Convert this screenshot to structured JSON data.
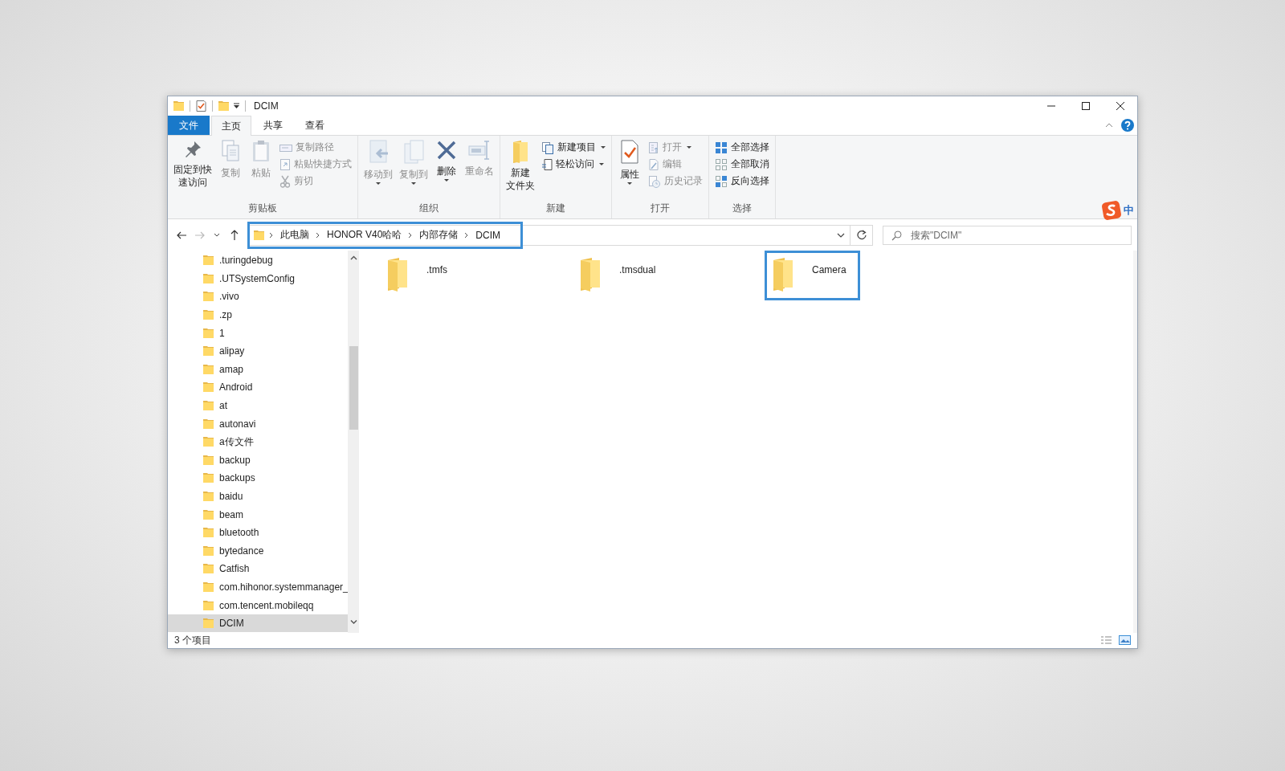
{
  "window": {
    "title": "DCIM"
  },
  "ribbon_tabs": [
    {
      "label": "文件",
      "kind": "file",
      "selected": false
    },
    {
      "label": "主页",
      "kind": "tab",
      "selected": true
    },
    {
      "label": "共享",
      "kind": "tab",
      "selected": false
    },
    {
      "label": "查看",
      "kind": "tab",
      "selected": false
    }
  ],
  "ribbon": {
    "groups": [
      {
        "label": "剪贴板",
        "items": [
          {
            "kind": "large",
            "lines": [
              "固定到快",
              "速访问"
            ],
            "disabled": false,
            "dropdown": false
          },
          {
            "kind": "large",
            "label": "复制",
            "disabled": true,
            "dropdown": false
          },
          {
            "kind": "large",
            "label": "粘贴",
            "disabled": true,
            "dropdown": false
          },
          {
            "kind": "small",
            "label": "复制路径",
            "disabled": true,
            "dropdown": false
          },
          {
            "kind": "small",
            "label": "粘贴快捷方式",
            "disabled": true,
            "dropdown": false
          },
          {
            "kind": "small",
            "label": "剪切",
            "disabled": true,
            "dropdown": false
          }
        ]
      },
      {
        "label": "组织",
        "items": [
          {
            "kind": "large",
            "label": "移动到",
            "disabled": true,
            "dropdown": true
          },
          {
            "kind": "large",
            "label": "复制到",
            "disabled": true,
            "dropdown": true
          },
          {
            "kind": "large",
            "label": "删除",
            "disabled": false,
            "dropdown": true
          },
          {
            "kind": "large",
            "label": "重命名",
            "disabled": true,
            "dropdown": false
          }
        ]
      },
      {
        "label": "新建",
        "items": [
          {
            "kind": "large",
            "lines": [
              "新建",
              "文件夹"
            ],
            "disabled": false,
            "dropdown": false
          },
          {
            "kind": "small",
            "label": "新建项目",
            "disabled": false,
            "dropdown": true
          },
          {
            "kind": "small",
            "label": "轻松访问",
            "disabled": false,
            "dropdown": true
          }
        ]
      },
      {
        "label": "打开",
        "items": [
          {
            "kind": "large",
            "label": "属性",
            "disabled": false,
            "dropdown": true
          },
          {
            "kind": "small",
            "label": "打开",
            "disabled": true,
            "dropdown": true
          },
          {
            "kind": "small",
            "label": "编辑",
            "disabled": true,
            "dropdown": false
          },
          {
            "kind": "small",
            "label": "历史记录",
            "disabled": true,
            "dropdown": false
          }
        ]
      },
      {
        "label": "选择",
        "items": [
          {
            "kind": "small",
            "label": "全部选择",
            "disabled": false,
            "dropdown": false
          },
          {
            "kind": "small",
            "label": "全部取消",
            "disabled": false,
            "dropdown": false
          },
          {
            "kind": "small",
            "label": "反向选择",
            "disabled": false,
            "dropdown": false
          }
        ]
      }
    ]
  },
  "ime": {
    "label": "中"
  },
  "address": {
    "highlighted": true,
    "crumbs": [
      "此电脑",
      "HONOR V40哈哈",
      "内部存储",
      "DCIM"
    ]
  },
  "search": {
    "placeholder": "搜索\"DCIM\""
  },
  "nav": {
    "items": [
      {
        "name": ".turingdebug",
        "selected": false
      },
      {
        "name": ".UTSystemConfig",
        "selected": false
      },
      {
        "name": ".vivo",
        "selected": false
      },
      {
        "name": ".zp",
        "selected": false
      },
      {
        "name": "1",
        "selected": false
      },
      {
        "name": "alipay",
        "selected": false
      },
      {
        "name": "amap",
        "selected": false
      },
      {
        "name": "Android",
        "selected": false
      },
      {
        "name": "at",
        "selected": false
      },
      {
        "name": "autonavi",
        "selected": false
      },
      {
        "name": "a传文件",
        "selected": false
      },
      {
        "name": "backup",
        "selected": false
      },
      {
        "name": "backups",
        "selected": false
      },
      {
        "name": "baidu",
        "selected": false
      },
      {
        "name": "beam",
        "selected": false
      },
      {
        "name": "bluetooth",
        "selected": false
      },
      {
        "name": "bytedance",
        "selected": false
      },
      {
        "name": "Catfish",
        "selected": false
      },
      {
        "name": "com.hihonor.systemmanager_",
        "selected": false
      },
      {
        "name": "com.tencent.mobileqq",
        "selected": false
      },
      {
        "name": "DCIM",
        "selected": true
      }
    ]
  },
  "files": [
    {
      "name": ".tmfs",
      "highlighted": false
    },
    {
      "name": ".tmsdual",
      "highlighted": false
    },
    {
      "name": "Camera",
      "highlighted": true
    }
  ],
  "status_bar": {
    "count": "3 个项目"
  }
}
